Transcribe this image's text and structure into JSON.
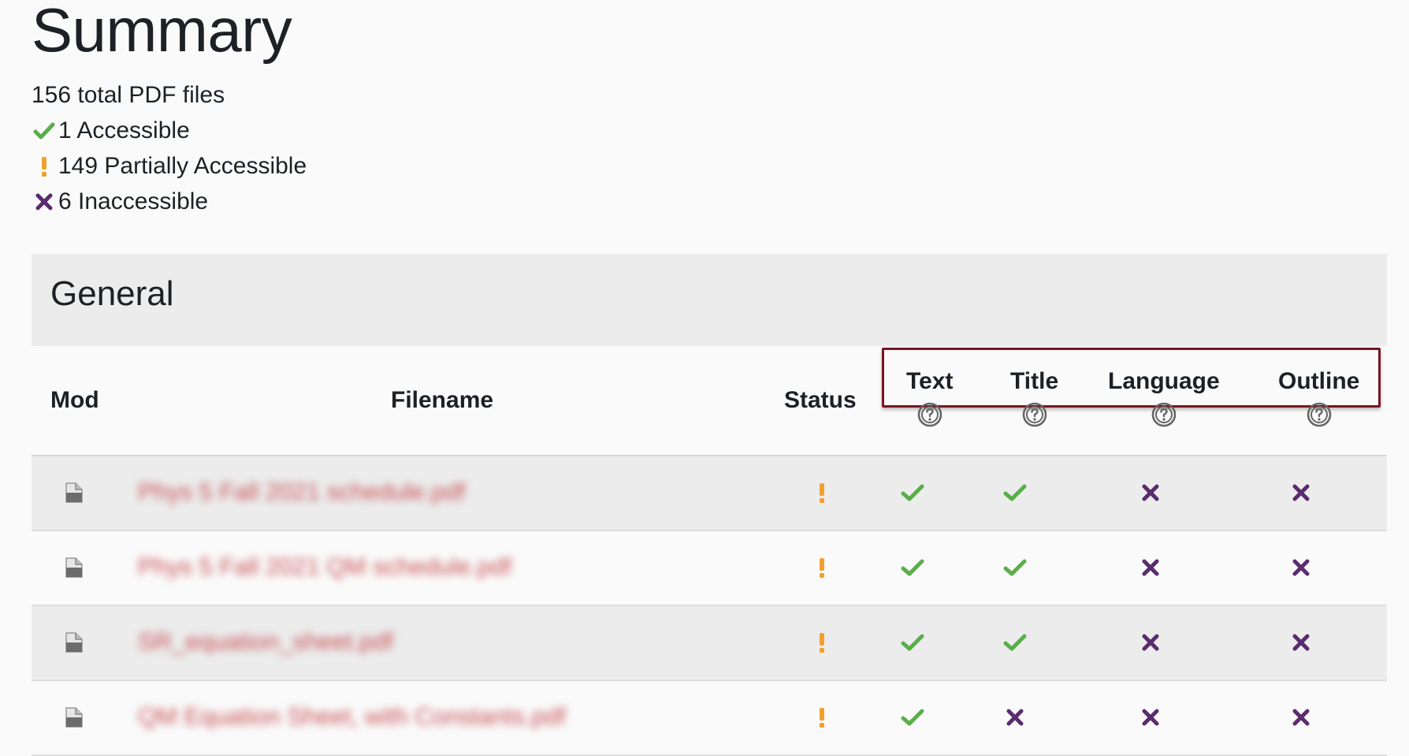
{
  "page": {
    "title": "Summary"
  },
  "summary": {
    "total": "156 total PDF files",
    "accessible": "1 Accessible",
    "partial": "149 Partially Accessible",
    "inaccessible": "6 Inaccessible"
  },
  "section": {
    "title": "General"
  },
  "table": {
    "headers": {
      "mod": "Mod",
      "filename": "Filename",
      "status": "Status",
      "text": "Text",
      "title": "Title",
      "language": "Language",
      "outline": "Outline"
    },
    "rows": [
      {
        "filename": "Phys 5 Fall 2021 schedule.pdf",
        "status": "partial",
        "text": "pass",
        "title": "pass",
        "language": "fail",
        "outline": "fail"
      },
      {
        "filename": "Phys 5 Fall 2021 QM schedule.pdf",
        "status": "partial",
        "text": "pass",
        "title": "pass",
        "language": "fail",
        "outline": "fail"
      },
      {
        "filename": "SR_equation_sheet.pdf",
        "status": "partial",
        "text": "pass",
        "title": "pass",
        "language": "fail",
        "outline": "fail"
      },
      {
        "filename": "QM Equation Sheet, with Constants.pdf",
        "status": "partial",
        "text": "pass",
        "title": "fail",
        "language": "fail",
        "outline": "fail"
      }
    ]
  },
  "colors": {
    "accessible": "#5aae4a",
    "partial": "#f0a030",
    "inaccessible": "#5a2c6e",
    "highlight_border": "#7a1520"
  },
  "icons": {
    "accessible": "check-icon",
    "partial": "exclamation-icon",
    "inaccessible": "cross-icon",
    "help": "question-circle-icon",
    "file": "file-icon"
  }
}
